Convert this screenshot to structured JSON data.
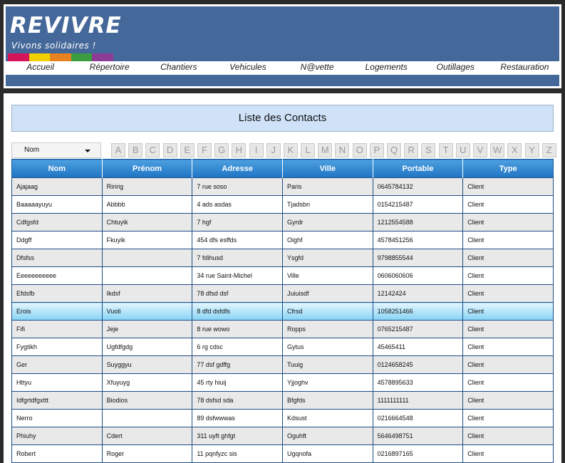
{
  "brand": {
    "name": "REVIVRE",
    "tagline": "Vivons solidaires !",
    "bar_colors": [
      "#d6145a",
      "#f3d100",
      "#e8821e",
      "#3a9d3f",
      "#8c3c94"
    ]
  },
  "nav": [
    "Accueil",
    "Répertoire",
    "Chantiers",
    "Vehicules",
    "N@vette",
    "Logements",
    "Outillages",
    "Restauration"
  ],
  "page_title": "Liste des Contacts",
  "sort": {
    "selected": "Nom"
  },
  "letters": [
    "A",
    "B",
    "C",
    "D",
    "E",
    "F",
    "G",
    "H",
    "I",
    "J",
    "K",
    "L",
    "M",
    "N",
    "O",
    "P",
    "Q",
    "R",
    "S",
    "T",
    "U",
    "V",
    "W",
    "X",
    "Y",
    "Z"
  ],
  "table": {
    "columns": [
      "Nom",
      "Prénom",
      "Adresse",
      "Ville",
      "Portable",
      "Type"
    ],
    "selected_row": 7,
    "rows": [
      [
        "Ajajaag",
        "Riririg",
        "7 rue soso",
        "Paris",
        "0645784132",
        "Client"
      ],
      [
        "Baaaaayuyu",
        "Abbbb",
        "4 ads asdas",
        "Tjadsbn",
        "0154215487",
        "Client"
      ],
      [
        "Cdfgsfd",
        "Chtuyik",
        "7 hgf",
        "Gyrdr",
        "1212554588",
        "Client"
      ],
      [
        "Ddgff",
        "Fkuyik",
        "454 dfs esffds",
        "Oighf",
        "4578451256",
        "Client"
      ],
      [
        "Dfsfss",
        "",
        "7 fdihusd",
        "Ysgfd",
        "9798855544",
        "Client"
      ],
      [
        "Eeeeeeeeeee",
        "",
        "34 rue Saint-Michel",
        "Ville",
        "0606060606",
        "Client"
      ],
      [
        "Efdsfb",
        "Ikdsf",
        "78 dfsd dsf",
        "Juiuisdf",
        "12142424",
        "Client"
      ],
      [
        "Erois",
        "Vuoli",
        "8 dfd dsfdfs",
        "Cfrsd",
        "1058251466",
        "Client"
      ],
      [
        "Fifi",
        "Jeje",
        "8 rue wowo",
        "Ropps",
        "0765215487",
        "Client"
      ],
      [
        "Fygtikh",
        "Ugfdfgdg",
        "6 rg cdsc",
        "Gytus",
        "45465411",
        "Client"
      ],
      [
        "Ger",
        "Suyggyu",
        "77 dsf gdffg",
        "Tuuig",
        "0124658245",
        "Client"
      ],
      [
        "Httyu",
        "Xfuyuyg",
        "45 rty hiuij",
        "Yjjoghv",
        "4578895633",
        "Client"
      ],
      [
        "Idfgrtdfgxttt",
        "Biodios",
        "78 dsfsd sda",
        "Bfgfds",
        "1111111111",
        "Client"
      ],
      [
        "Nerro",
        "",
        "89 dsfwwwas",
        "Kdsust",
        "0216664548",
        "Client"
      ],
      [
        "Phiuhy",
        "Cdert",
        "311 uyft ghfgt",
        "Oguhft",
        "5646498751",
        "Client"
      ],
      [
        "Robert",
        "Roger",
        "11 pqnfyzc sis",
        "Ugqnofa",
        "0216897165",
        "Client"
      ]
    ]
  }
}
